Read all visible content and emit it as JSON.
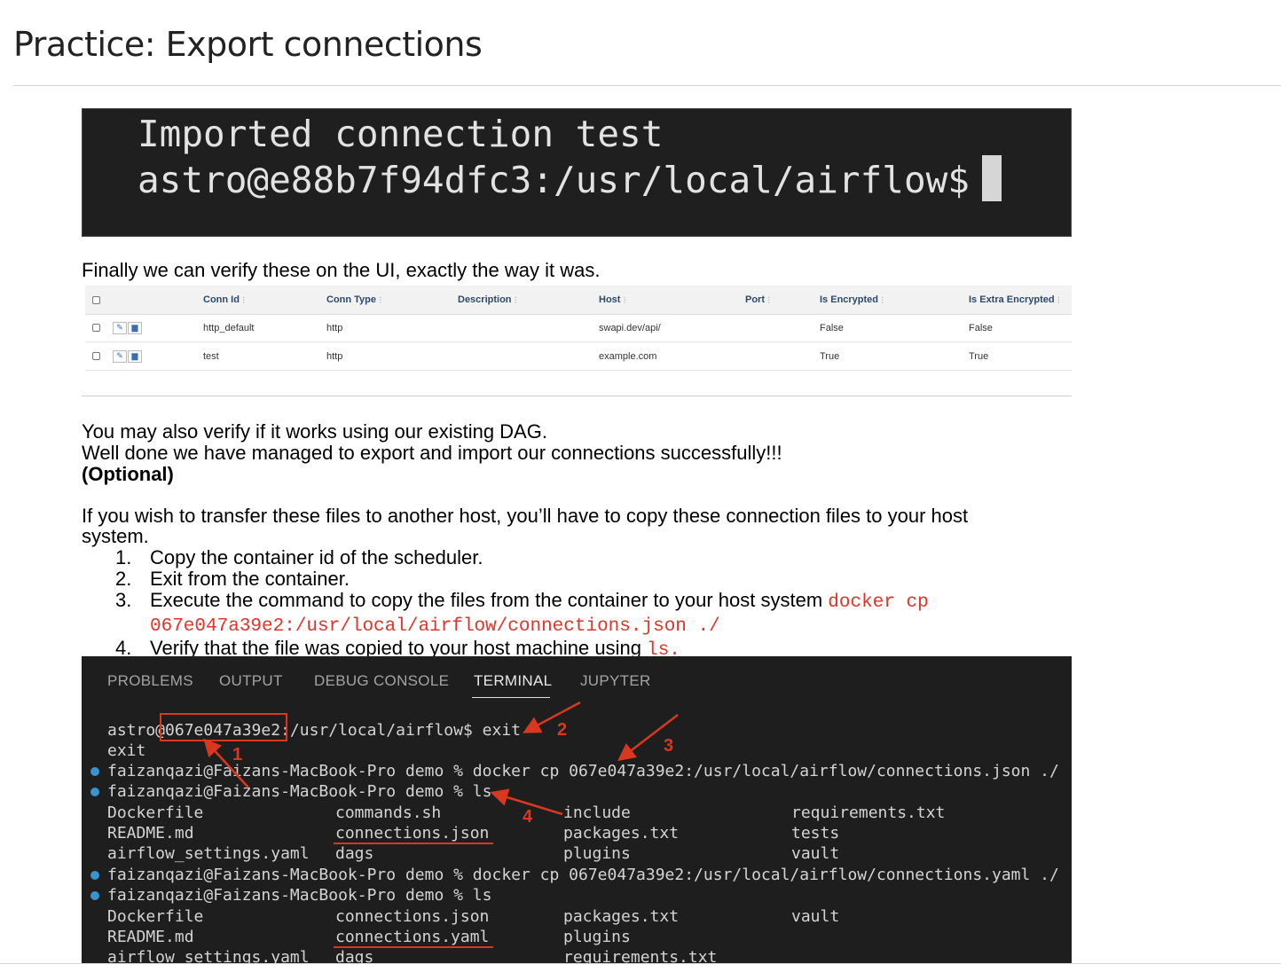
{
  "page": {
    "title": "Practice: Export connections"
  },
  "screenshot1": {
    "line1": "Imported connection test",
    "line2": "astro@e88b7f94dfc3:/usr/local/airflow$"
  },
  "text": {
    "verify_ui": "Finally we can verify these on the UI, exactly the way it was.",
    "dag_verify": "You may also verify if it works using our existing DAG.",
    "well_done": "Well done we have managed to export and import our connections successfully!!!",
    "optional": "(Optional)",
    "transfer_1": "If you wish to transfer these files to another host, you’ll have to copy these connection files to your host",
    "transfer_2": "system."
  },
  "connections_table": {
    "headers": [
      "Conn Id",
      "Conn Type",
      "Description",
      "Host",
      "Port",
      "Is Encrypted",
      "Is Extra Encrypted"
    ],
    "rows": [
      [
        "http_default",
        "http",
        "",
        "swapi.dev/api/",
        "",
        "False",
        "False"
      ],
      [
        "test",
        "http",
        "",
        "example.com",
        "",
        "True",
        "True"
      ]
    ]
  },
  "steps": [
    {
      "num": "1.",
      "text": "Copy the container id of the scheduler."
    },
    {
      "num": "2.",
      "text": "Exit from the container."
    },
    {
      "num": "3.",
      "text": "Execute the command to copy the files from the container to your host system ",
      "code": "docker cp",
      "code2": "067e047a39e2:/usr/local/airflow/connections.json ./"
    },
    {
      "num": "4.",
      "text": "Verify that the file was copied to your host machine using ",
      "code": "ls."
    }
  ],
  "terminal": {
    "tabs": [
      "PROBLEMS",
      "OUTPUT",
      "DEBUG CONSOLE",
      "TERMINAL",
      "JUPYTER"
    ],
    "active_tab": "TERMINAL",
    "lines": [
      "astro@067e047a39e2:/usr/local/airflow$ exit",
      "exit",
      "faizanqazi@Faizans-MacBook-Pro demo % docker cp 067e047a39e2:/usr/local/airflow/connections.json ./",
      "faizanqazi@Faizans-MacBook-Pro demo % ls"
    ],
    "ls1": [
      [
        "Dockerfile",
        "commands.sh",
        "include",
        "requirements.txt"
      ],
      [
        "README.md",
        "connections.json",
        "packages.txt",
        "tests"
      ],
      [
        "airflow_settings.yaml",
        "dags",
        "plugins",
        "vault"
      ]
    ],
    "lines2": [
      "faizanqazi@Faizans-MacBook-Pro demo % docker cp 067e047a39e2:/usr/local/airflow/connections.yaml ./",
      "faizanqazi@Faizans-MacBook-Pro demo % ls"
    ],
    "ls2": [
      [
        "Dockerfile",
        "connections.json",
        "packages.txt",
        "vault"
      ],
      [
        "README.md",
        "connections.yaml",
        "plugins",
        ""
      ],
      [
        "airflow_settings.yaml",
        "dags",
        "requirements.txt",
        ""
      ]
    ],
    "annotations": [
      "1",
      "2",
      "3",
      "4"
    ]
  },
  "colors": {
    "code_red": "#e8312b",
    "annotation_red": "#d9381e",
    "terminal_bg": "#1e1e1e",
    "prompt_dot": "#3794d1"
  }
}
